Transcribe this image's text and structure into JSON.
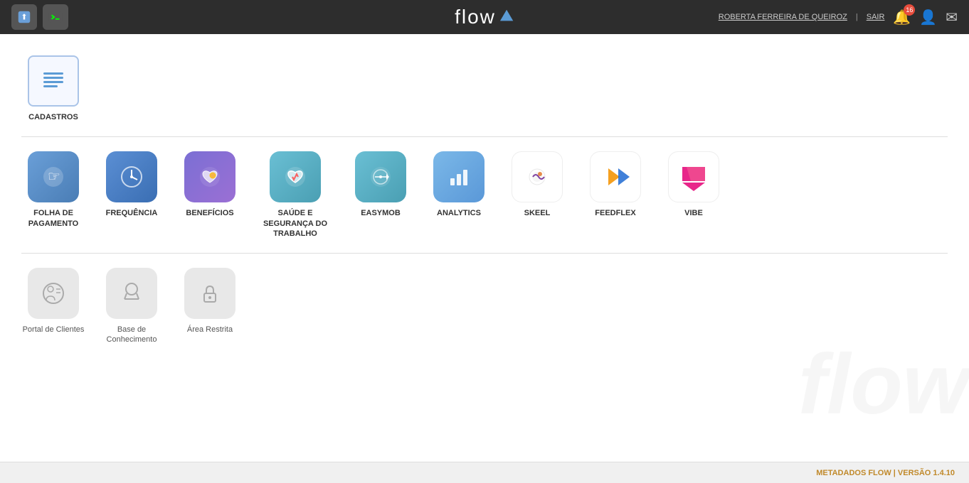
{
  "header": {
    "logo": "flow",
    "logo_icon": "▲",
    "user_name": "ROBERTA FERREIRA DE QUEIROZ",
    "separator": "|",
    "logout_label": "SAIR",
    "notification_count": "16",
    "icon_upload": "⬆",
    "icon_terminal": "❯"
  },
  "sections": {
    "cadastros": {
      "label": "CADASTROS",
      "icon": "≡"
    },
    "apps": [
      {
        "id": "folha",
        "label": "FOLHA DE PAGAMENTO",
        "icon": "folha",
        "color_class": "icon-folha"
      },
      {
        "id": "frequencia",
        "label": "FREQUÊNCIA",
        "icon": "frequencia",
        "color_class": "icon-frequencia"
      },
      {
        "id": "beneficios",
        "label": "BENEFÍCIOS",
        "icon": "beneficios",
        "color_class": "icon-beneficios"
      },
      {
        "id": "saude",
        "label": "SAÚDE E SEGURANÇA DO TRABALHO",
        "icon": "saude",
        "color_class": "icon-saude"
      },
      {
        "id": "easymob",
        "label": "EASYMOB",
        "icon": "easymob",
        "color_class": "icon-easymob"
      },
      {
        "id": "analytics",
        "label": "ANALYTICS",
        "icon": "analytics",
        "color_class": "icon-analytics"
      },
      {
        "id": "skeel",
        "label": "SKEEL",
        "icon": "skeel",
        "color_class": "icon-skeel"
      },
      {
        "id": "feedflex",
        "label": "FEEDFLEX",
        "icon": "feedflex",
        "color_class": "icon-feedflex"
      },
      {
        "id": "vibe",
        "label": "VIBE",
        "icon": "vibe",
        "color_class": "icon-vibe"
      }
    ],
    "portal_items": [
      {
        "id": "portal",
        "label": "Portal de Clientes",
        "icon": "⚙"
      },
      {
        "id": "base",
        "label": "Base de Conhecimento",
        "icon": "🎓"
      },
      {
        "id": "restrita",
        "label": "Área Restrita",
        "icon": "🔒"
      }
    ]
  },
  "footer": {
    "text": "METADADOS FLOW | VERSÃO 1.4.10"
  }
}
